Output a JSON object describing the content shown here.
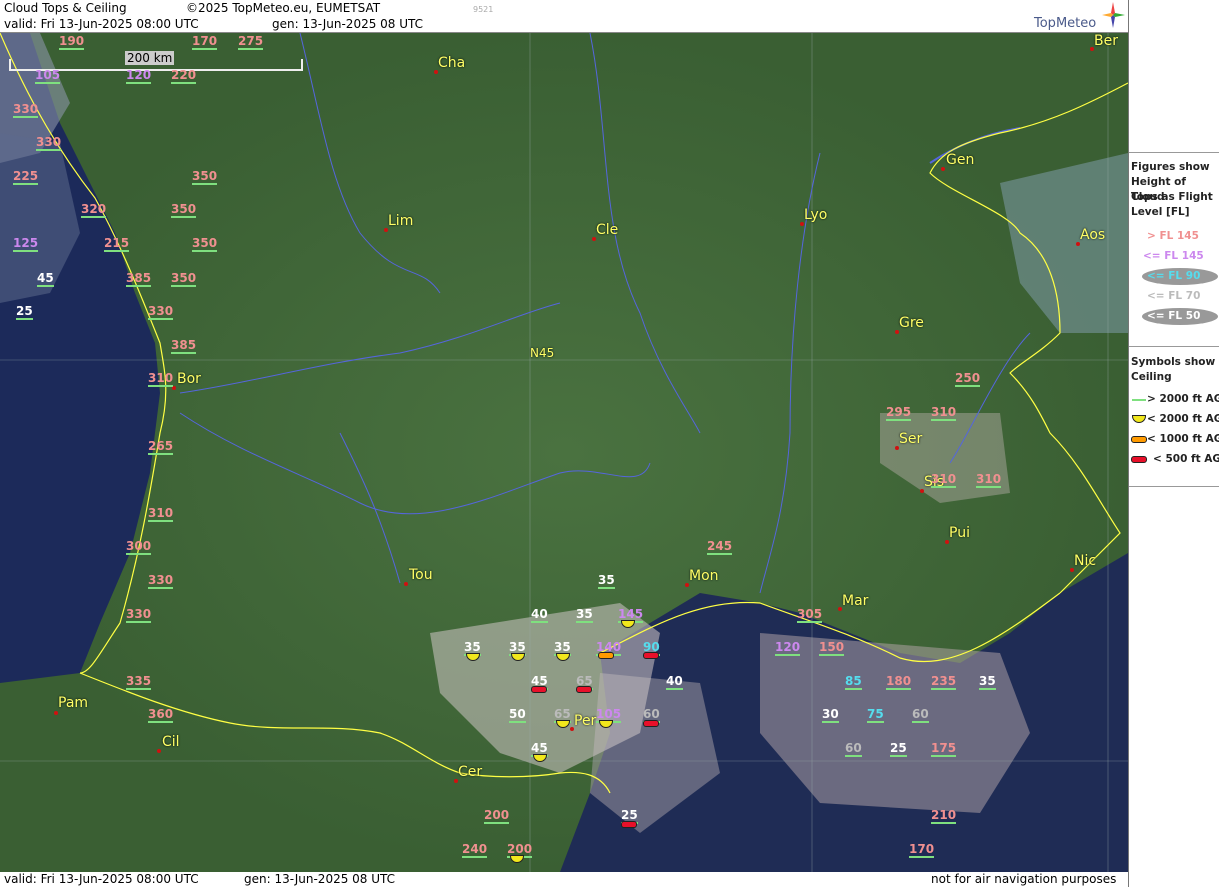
{
  "header": {
    "title": "Cloud Tops & Ceiling",
    "copyright": "©2025 TopMeteo.eu, EUMETSAT",
    "valid": "valid:  Fri  13-Jun-2025  08:00 UTC",
    "gen": "gen: 13-Jun-2025 08 UTC",
    "code": "9521",
    "brand": "TopMeteo"
  },
  "footer": {
    "valid": "valid:  Fri  13-Jun-2025  08:00 UTC",
    "gen": "gen: 13-Jun-2025 08 UTC",
    "disclaimer": "not for air navigation purposes"
  },
  "scale_bar": "200 km",
  "grid_label": "N45",
  "legend": {
    "figures_title": [
      "Figures show",
      "Height of Cloud",
      "Tops as Flight",
      "Level  [FL]"
    ],
    "fl_items": [
      {
        "label": "> FL 145",
        "color": "#f09090"
      },
      {
        "label": "<= FL 145",
        "color": "#cc88ee"
      },
      {
        "label": "<= FL 90",
        "color": "#55ddee"
      },
      {
        "label": "<= FL 70",
        "color": "#bbbbbb"
      },
      {
        "label": "<= FL 50",
        "color": "#ffffff"
      }
    ],
    "symbols_title": [
      "Symbols show",
      "Ceiling"
    ],
    "symbol_items": [
      {
        "label": "> 2000 ft AGL",
        "color": "#7fe07f"
      },
      {
        "label": "< 2000 ft AGL",
        "color": "#f2e81c"
      },
      {
        "label": "< 1000 ft AGL",
        "color": "#ff9a00"
      },
      {
        "label": "< 500 ft AGL",
        "color": "#e8102a"
      }
    ]
  },
  "cities": [
    "Cha",
    "Ber",
    "Gen",
    "Lim",
    "Cle",
    "Lyo",
    "Aos",
    "Gre",
    "Bor",
    "Ser",
    "Sis",
    "Pui",
    "Tou",
    "Mon",
    "Nic",
    "Mar",
    "Pam",
    "Cil",
    "Per",
    "Cer"
  ],
  "cloud_top_figures": [
    "190",
    "170",
    "275",
    "105",
    "120",
    "220",
    "330",
    "330",
    "350",
    "225",
    "320",
    "350",
    "125",
    "215",
    "350",
    "45",
    "385",
    "350",
    "25",
    "330",
    "385",
    "310",
    "265",
    "310",
    "300",
    "330",
    "330",
    "335",
    "360",
    "245",
    "35",
    "40",
    "35",
    "145",
    "35",
    "35",
    "35",
    "140",
    "90",
    "45",
    "65",
    "40",
    "305",
    "120",
    "150",
    "50",
    "65",
    "105",
    "60",
    "45",
    "85",
    "180",
    "235",
    "35",
    "30",
    "75",
    "60",
    "60",
    "25",
    "175",
    "200",
    "25",
    "210",
    "240",
    "200",
    "170",
    "250",
    "295",
    "310",
    "310",
    "310"
  ],
  "ceiling_symbols": {
    "yellow": 8,
    "orange": 2,
    "red": 5
  }
}
